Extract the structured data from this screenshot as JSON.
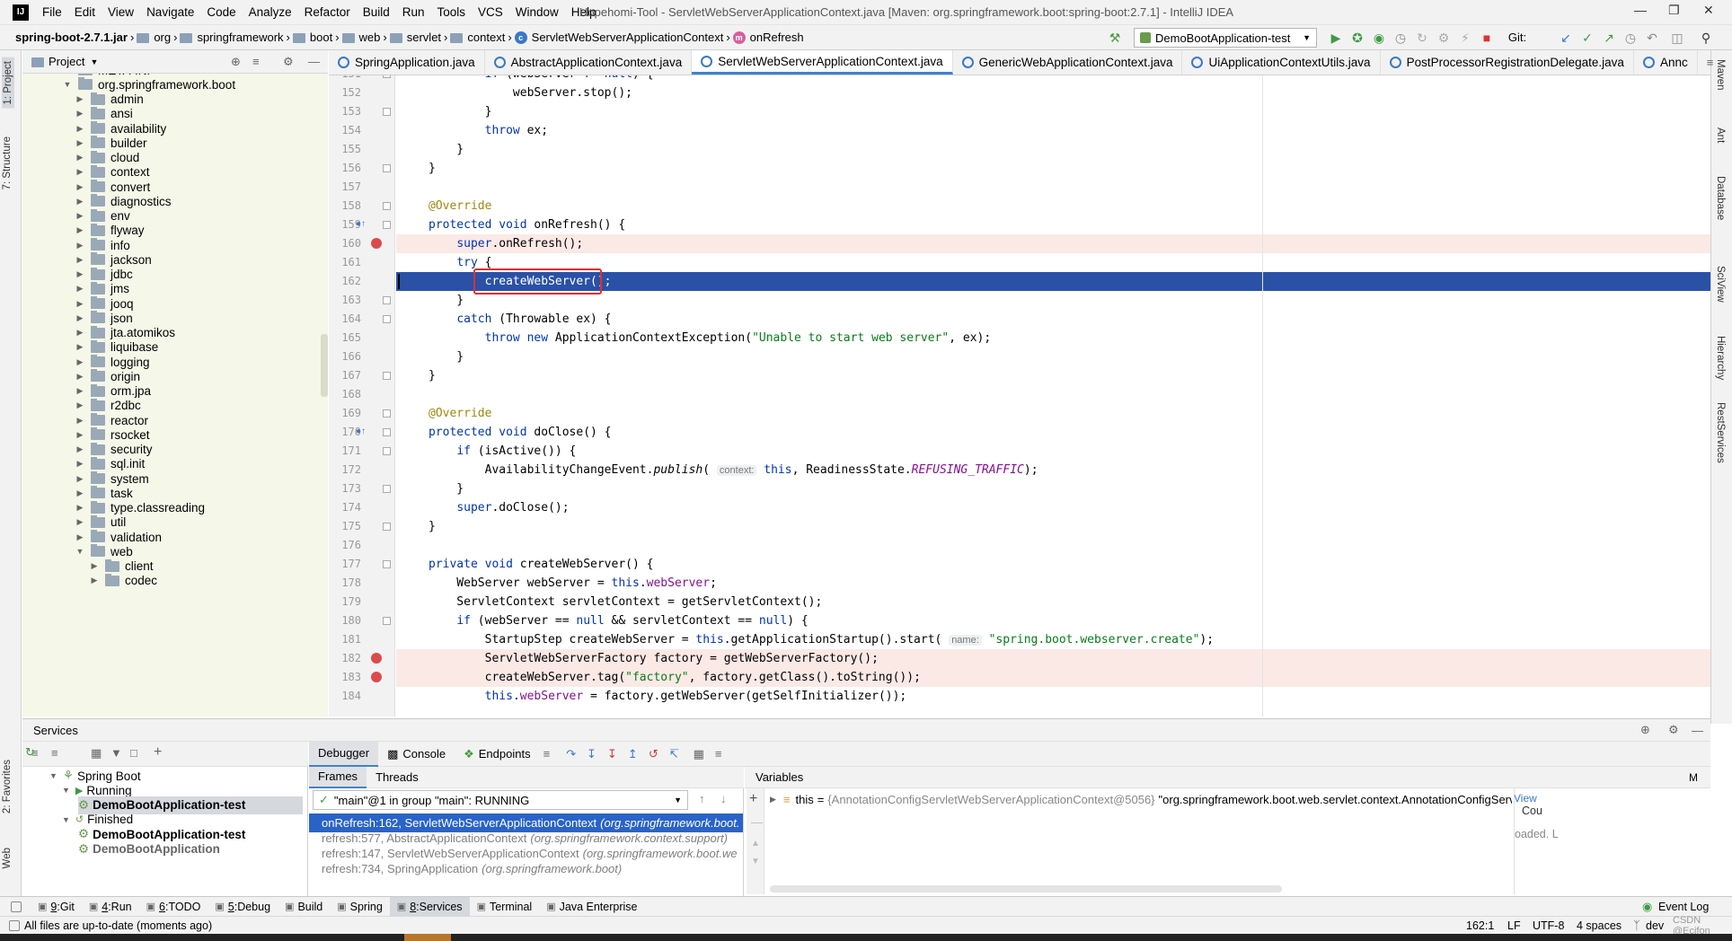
{
  "menu": {
    "items": [
      "File",
      "Edit",
      "View",
      "Navigate",
      "Code",
      "Analyze",
      "Refactor",
      "Build",
      "Run",
      "Tools",
      "VCS",
      "Window",
      "Help"
    ],
    "window_title": "Hopehomi-Tool - ServletWebServerApplicationContext.java [Maven: org.springframework.boot:spring-boot:2.7.1] - IntelliJ IDEA"
  },
  "breadcrumb": [
    "spring-boot-2.7.1.jar",
    "org",
    "springframework",
    "boot",
    "web",
    "servlet",
    "context",
    "ServletWebServerApplicationContext",
    "onRefresh"
  ],
  "toolbar": {
    "run_config": "DemoBootApplication-test",
    "git_label": "Git:"
  },
  "project_panel": {
    "title": "Project",
    "tree": [
      {
        "label": "META-INF",
        "level": 1,
        "expanded": false
      },
      {
        "label": "org.springframework.boot",
        "level": 1,
        "expanded": true
      },
      {
        "label": "admin",
        "level": 2,
        "expanded": false
      },
      {
        "label": "ansi",
        "level": 2,
        "expanded": false
      },
      {
        "label": "availability",
        "level": 2,
        "expanded": false
      },
      {
        "label": "builder",
        "level": 2,
        "expanded": false
      },
      {
        "label": "cloud",
        "level": 2,
        "expanded": false
      },
      {
        "label": "context",
        "level": 2,
        "expanded": false
      },
      {
        "label": "convert",
        "level": 2,
        "expanded": false
      },
      {
        "label": "diagnostics",
        "level": 2,
        "expanded": false
      },
      {
        "label": "env",
        "level": 2,
        "expanded": false
      },
      {
        "label": "flyway",
        "level": 2,
        "expanded": false
      },
      {
        "label": "info",
        "level": 2,
        "expanded": false
      },
      {
        "label": "jackson",
        "level": 2,
        "expanded": false
      },
      {
        "label": "jdbc",
        "level": 2,
        "expanded": false
      },
      {
        "label": "jms",
        "level": 2,
        "expanded": false
      },
      {
        "label": "jooq",
        "level": 2,
        "expanded": false
      },
      {
        "label": "json",
        "level": 2,
        "expanded": false
      },
      {
        "label": "jta.atomikos",
        "level": 2,
        "expanded": false
      },
      {
        "label": "liquibase",
        "level": 2,
        "expanded": false
      },
      {
        "label": "logging",
        "level": 2,
        "expanded": false
      },
      {
        "label": "origin",
        "level": 2,
        "expanded": false
      },
      {
        "label": "orm.jpa",
        "level": 2,
        "expanded": false
      },
      {
        "label": "r2dbc",
        "level": 2,
        "expanded": false
      },
      {
        "label": "reactor",
        "level": 2,
        "expanded": false
      },
      {
        "label": "rsocket",
        "level": 2,
        "expanded": false
      },
      {
        "label": "security",
        "level": 2,
        "expanded": false
      },
      {
        "label": "sql.init",
        "level": 2,
        "expanded": false
      },
      {
        "label": "system",
        "level": 2,
        "expanded": false
      },
      {
        "label": "task",
        "level": 2,
        "expanded": false
      },
      {
        "label": "type.classreading",
        "level": 2,
        "expanded": false
      },
      {
        "label": "util",
        "level": 2,
        "expanded": false
      },
      {
        "label": "validation",
        "level": 2,
        "expanded": false
      },
      {
        "label": "web",
        "level": 2,
        "expanded": true
      },
      {
        "label": "client",
        "level": 3,
        "expanded": false
      },
      {
        "label": "codec",
        "level": 3,
        "expanded": false
      }
    ]
  },
  "editor_tabs": [
    "SpringApplication.java",
    "AbstractApplicationContext.java",
    "ServletWebServerApplicationContext.java",
    "GenericWebApplicationContext.java",
    "UiApplicationContextUtils.java",
    "PostProcessorRegistrationDelegate.java",
    "Annc"
  ],
  "active_tab": 2,
  "code": {
    "lines": [
      {
        "n": "151",
        "html": "        <span class=\"kw\">if</span> (webServer != <span class=\"kw\">null</span>) {"
      },
      {
        "n": "152",
        "html": "            webServer.stop();"
      },
      {
        "n": "153",
        "html": "        }"
      },
      {
        "n": "154",
        "html": "        <span class=\"kw\">throw</span> ex;"
      },
      {
        "n": "155",
        "html": "    }"
      },
      {
        "n": "156",
        "html": "}"
      },
      {
        "n": "157",
        "html": ""
      },
      {
        "n": "158",
        "html": "<span class=\"an\">@Override</span>"
      },
      {
        "n": "159",
        "html": "<span class=\"kw\">protected void</span> onRefresh() {"
      },
      {
        "n": "160",
        "html": "    <span class=\"kw\">super</span>.onRefresh();"
      },
      {
        "n": "161",
        "html": "    <span class=\"kw\">try</span> {"
      },
      {
        "n": "162",
        "html": "        createWebServer();"
      },
      {
        "n": "163",
        "html": "    }"
      },
      {
        "n": "164",
        "html": "    <span class=\"kw\">catch</span> (Throwable ex) {"
      },
      {
        "n": "165",
        "html": "        <span class=\"kw\">throw new</span> ApplicationContextException(<span class=\"st\">\"Unable to start web server\"</span>, ex);"
      },
      {
        "n": "166",
        "html": "    }"
      },
      {
        "n": "167",
        "html": "}"
      },
      {
        "n": "168",
        "html": ""
      },
      {
        "n": "169",
        "html": "<span class=\"an\">@Override</span>"
      },
      {
        "n": "170",
        "html": "<span class=\"kw\">protected void</span> doClose() {"
      },
      {
        "n": "171",
        "html": "    <span class=\"kw\">if</span> (isActive()) {"
      },
      {
        "n": "172",
        "html": "        AvailabilityChangeEvent.<span class=\"it\">publish</span>( <span class=\"hint\">context:</span> <span class=\"kw\">this</span>, ReadinessState.<span class=\"fd it\">REFUSING_TRAFFIC</span>);"
      },
      {
        "n": "173",
        "html": "    }"
      },
      {
        "n": "174",
        "html": "    <span class=\"kw\">super</span>.doClose();"
      },
      {
        "n": "175",
        "html": "}"
      },
      {
        "n": "176",
        "html": ""
      },
      {
        "n": "177",
        "html": "<span class=\"kw\">private void</span> createWebServer() {"
      },
      {
        "n": "178",
        "html": "    WebServer webServer = <span class=\"kw\">this</span>.<span class=\"fd\">webServer</span>;"
      },
      {
        "n": "179",
        "html": "    ServletContext servletContext = getServletContext();"
      },
      {
        "n": "180",
        "html": "    <span class=\"kw\">if</span> (webServer == <span class=\"kw\">null</span> &amp;&amp; servletContext == <span class=\"kw\">null</span>) {"
      },
      {
        "n": "181",
        "html": "        StartupStep createWebServer = <span class=\"kw\">this</span>.getApplicationStartup().start( <span class=\"hint\">name:</span> <span class=\"st\">\"spring.boot.webserver.create\"</span>);"
      },
      {
        "n": "182",
        "html": "        ServletWebServerFactory factory = getWebServerFactory();"
      },
      {
        "n": "183",
        "html": "        createWebServer.tag(<span class=\"st\">\"factory\"</span>, factory.getClass().toString());"
      },
      {
        "n": "184",
        "html": "        <span class=\"kw\">this</span>.<span class=\"fd\">webServer</span> = factory.getWebServer(getSelfInitializer());"
      }
    ]
  },
  "services": {
    "title": "Services",
    "tree": [
      {
        "label": "Spring Boot",
        "level": 0
      },
      {
        "label": "Running",
        "level": 1
      },
      {
        "label": "DemoBootApplication-test",
        "level": 2,
        "bold": true,
        "selected": true
      },
      {
        "label": "Finished",
        "level": 1
      },
      {
        "label": "DemoBootApplication-test",
        "level": 2,
        "bold": true
      },
      {
        "label": "DemoBootApplication",
        "level": 2,
        "bold": true,
        "muted": true
      }
    ]
  },
  "debugger": {
    "tabs": [
      "Debugger",
      "Console",
      "Endpoints"
    ],
    "subtabs": [
      "Frames",
      "Threads"
    ],
    "thread": "\"main\"@1 in group \"main\": RUNNING",
    "frames": [
      {
        "method": "onRefresh:162, ServletWebServerApplicationContext",
        "pkg": "(org.springframework.boot."
      },
      {
        "method": "refresh:577, AbstractApplicationContext",
        "pkg": "(org.springframework.context.support)"
      },
      {
        "method": "refresh:147, ServletWebServerApplicationContext",
        "pkg": "(org.springframework.boot.we"
      },
      {
        "method": "refresh:734, SpringApplication",
        "pkg": "(org.springframework.boot)"
      }
    ],
    "variables_title": "Variables",
    "variable": {
      "name": "this",
      "value": "{AnnotationConfigServletWebServerApplicationContext@5056}",
      "text": "\"org.springframework.boot.web.servlet.context.AnnotationConfigServletWebServerApplica...",
      "link": "View"
    },
    "side_labels": [
      "Cou",
      "oaded. L"
    ]
  },
  "tool_windows": [
    {
      "num": "9",
      "label": "Git"
    },
    {
      "num": "4",
      "label": "Run"
    },
    {
      "num": "6",
      "label": "TODO"
    },
    {
      "num": "5",
      "label": "Debug"
    },
    {
      "num": "",
      "label": "Build"
    },
    {
      "num": "",
      "label": "Spring"
    },
    {
      "num": "8",
      "label": "Services",
      "active": true
    },
    {
      "num": "",
      "label": "Terminal"
    },
    {
      "num": "",
      "label": "Java Enterprise"
    }
  ],
  "event_log": "Event Log",
  "status": {
    "message": "All files are up-to-date (moments ago)",
    "position": "162:1",
    "line_sep": "LF",
    "encoding": "UTF-8",
    "indent": "4 spaces",
    "branch": "dev",
    "watermark": "CSDN @Ecifon"
  },
  "left_vtabs": [
    "1: Project",
    "7: Structure",
    "2: Favorites",
    "Web"
  ],
  "right_vtabs": [
    "Maven",
    "Ant",
    "Database",
    "SciView",
    "Hierarchy",
    "RestServices"
  ],
  "colors": {
    "selection": "#2a51a6",
    "breakpoint": "#db4b4b",
    "highlight_box": "#e0302c",
    "accent": "#4083c9"
  }
}
